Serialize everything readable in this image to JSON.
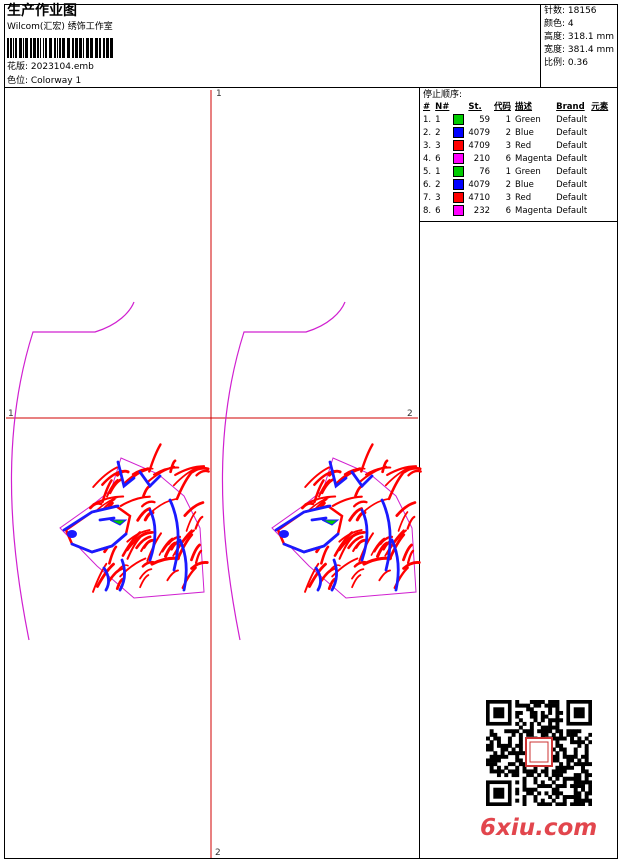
{
  "header": {
    "title": "生产作业图",
    "studio": "Wilcom(汇宏) 绣饰工作室",
    "design_label": "花版: 2023104.emb",
    "colorway_label": "色位: Colorway 1"
  },
  "stats": {
    "stitches": "针数: 18156",
    "colors": "颜色: 4",
    "height": "高度: 318.1 mm",
    "width": "宽度: 381.4 mm",
    "scale": "比例: 0.36"
  },
  "sequence": {
    "title": "停止顺序:",
    "headers": [
      "#",
      "N#",
      "St.",
      "代码",
      "描述",
      "Brand",
      "元素"
    ],
    "rows": [
      {
        "idx": "1.",
        "n": "1",
        "color": "#00cc00",
        "st": "59",
        "code": "1",
        "desc": "Green",
        "brand": "Default"
      },
      {
        "idx": "2.",
        "n": "2",
        "color": "#0000ff",
        "st": "4079",
        "code": "2",
        "desc": "Blue",
        "brand": "Default"
      },
      {
        "idx": "3.",
        "n": "3",
        "color": "#ff0000",
        "st": "4709",
        "code": "3",
        "desc": "Red",
        "brand": "Default"
      },
      {
        "idx": "4.",
        "n": "6",
        "color": "#ff00ff",
        "st": "210",
        "code": "6",
        "desc": "Magenta",
        "brand": "Default"
      },
      {
        "idx": "5.",
        "n": "1",
        "color": "#00cc00",
        "st": "76",
        "code": "1",
        "desc": "Green",
        "brand": "Default"
      },
      {
        "idx": "6.",
        "n": "2",
        "color": "#0000ff",
        "st": "4079",
        "code": "2",
        "desc": "Blue",
        "brand": "Default"
      },
      {
        "idx": "7.",
        "n": "3",
        "color": "#ff0000",
        "st": "4710",
        "code": "3",
        "desc": "Red",
        "brand": "Default"
      },
      {
        "idx": "8.",
        "n": "6",
        "color": "#ff00ff",
        "st": "232",
        "code": "6",
        "desc": "Magenta",
        "brand": "Default"
      }
    ]
  },
  "axes": {
    "top": "1",
    "left": "1",
    "right": "2",
    "bottom": "2"
  },
  "watermark": "6xiu.com",
  "colors": {
    "guide": "#d00000",
    "outline": "#d020d0",
    "red": "#ff0000",
    "blue": "#1a1aff",
    "green": "#00cc00"
  }
}
